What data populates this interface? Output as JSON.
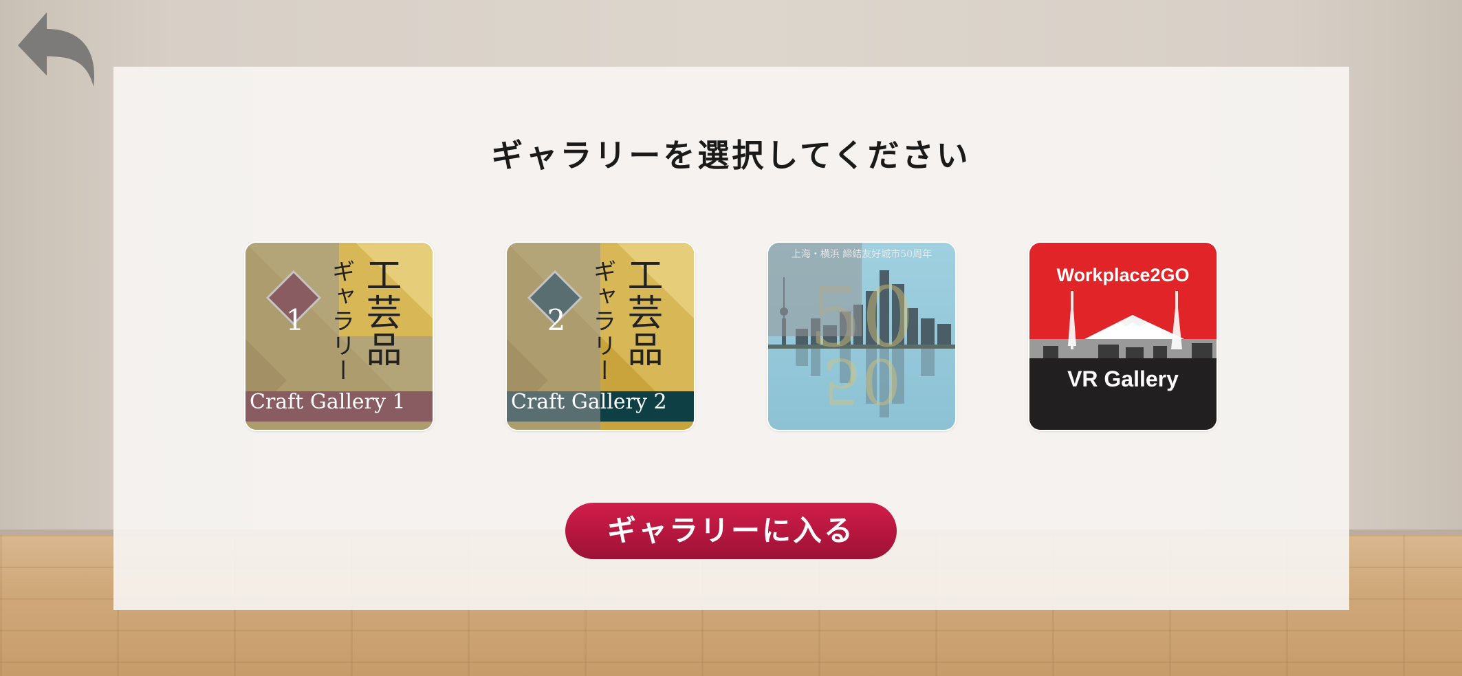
{
  "screen": {
    "title": "ギャラリーを選択してください",
    "back_icon": "back-arrow-icon"
  },
  "galleries": [
    {
      "number": "1",
      "vertical_title": "工芸品",
      "vertical_subtitle": "ギャラリー",
      "caption": "Craft Gallery 1",
      "accent_color": "#7a1822"
    },
    {
      "number": "2",
      "vertical_title": "工芸品",
      "vertical_subtitle": "ギャラリー",
      "caption": "Craft Gallery 2",
      "accent_color": "#0e3f45"
    },
    {
      "header": "上海・横浜 締結友好城市50周年",
      "accent_color": "#8fc3d6"
    },
    {
      "brand": "Workplace2GO",
      "subtitle": "VR Gallery",
      "accent_color": "#e02428"
    }
  ],
  "actions": {
    "enter_label": "ギャラリーに入る"
  }
}
